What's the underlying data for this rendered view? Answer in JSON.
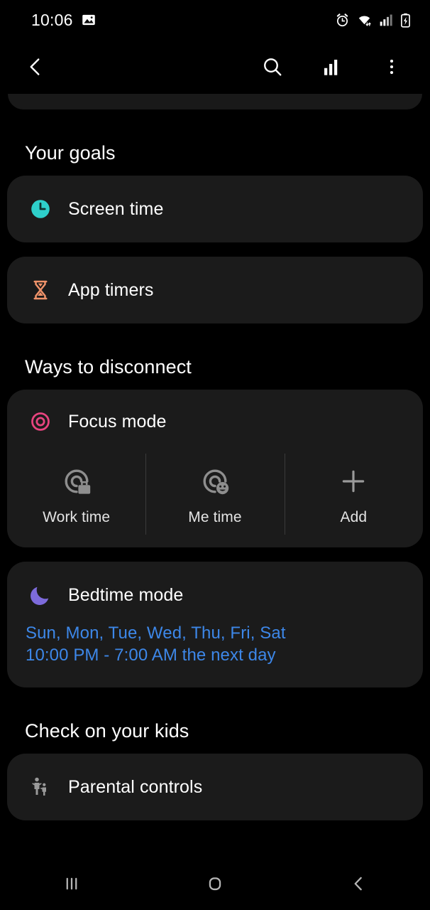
{
  "statusbar": {
    "time": "10:06",
    "left_icons": [
      {
        "name": "image-icon"
      }
    ],
    "right_icons": [
      {
        "name": "alarm-icon"
      },
      {
        "name": "wifi-icon"
      },
      {
        "name": "signal-bars-icon"
      },
      {
        "name": "battery-charging-icon"
      }
    ]
  },
  "toolbar": {
    "back": "back-icon",
    "actions": [
      {
        "name": "search-icon"
      },
      {
        "name": "usage-chart-icon"
      },
      {
        "name": "more-options-icon"
      }
    ]
  },
  "sections": {
    "goals": {
      "title": "Your goals",
      "items": [
        {
          "label": "Screen time",
          "icon": "clock-icon",
          "color": "#2ecfca"
        },
        {
          "label": "App timers",
          "icon": "hourglass-icon",
          "color": "#f0936a"
        }
      ]
    },
    "disconnect": {
      "title": "Ways to disconnect",
      "focus_mode": {
        "label": "Focus mode",
        "icon": "target-icon",
        "color": "#e8447f",
        "modes": [
          {
            "label": "Work time",
            "icon": "focus-work-icon"
          },
          {
            "label": "Me time",
            "icon": "focus-me-icon"
          },
          {
            "label": "Add",
            "icon": "plus-icon"
          }
        ]
      },
      "bedtime_mode": {
        "label": "Bedtime mode",
        "icon": "moon-icon",
        "color": "#7d6bdb",
        "schedule_days": "Sun, Mon, Tue, Wed, Thu, Fri, Sat",
        "schedule_time": "10:00 PM - 7:00 AM the next day",
        "accent": "#3d87e8"
      }
    },
    "kids": {
      "title": "Check on your kids",
      "items": [
        {
          "label": "Parental controls",
          "icon": "parent-child-icon",
          "color": "#9a9a9a"
        }
      ]
    }
  },
  "navbar": {
    "buttons": [
      {
        "name": "recents-button"
      },
      {
        "name": "home-button"
      },
      {
        "name": "back-button"
      }
    ]
  }
}
